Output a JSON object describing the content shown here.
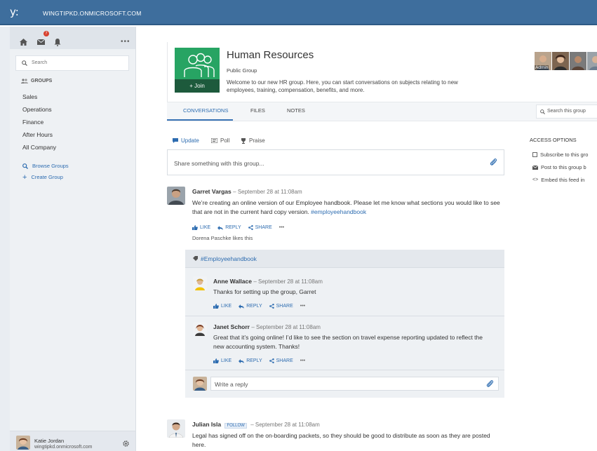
{
  "topbar": {
    "logo": "y:",
    "network_name": "WINGTIPKD.ONMICROSOFT.COM"
  },
  "sidebar": {
    "notification_count": "7",
    "search_placeholder": "Search",
    "groups_heading": "GROUPS",
    "groups": [
      "Sales",
      "Operations",
      "Finance",
      "After Hours",
      "All Company"
    ],
    "browse_groups": "Browse Groups",
    "create_group": "Create Group",
    "user": {
      "name": "Katie Jordan",
      "email": "wingtipkd.onmicrosoft.com"
    }
  },
  "group": {
    "join_label": "+ Join",
    "title": "Human Resources",
    "type": "Public Group",
    "description": "Welcome to our new HR group. Here, you can start conversations on subjects relating to new employees, training, compensation, benefits, and more.",
    "member_admin_label": "Admin",
    "tabs": [
      "CONVERSATIONS",
      "FILES",
      "NOTES"
    ],
    "search_placeholder": "Search this group"
  },
  "access": {
    "heading": "ACCESS OPTIONS",
    "options": [
      "Subscribe to this gro",
      "Post to this group b",
      "Embed this feed in"
    ]
  },
  "publisher": {
    "tabs": [
      "Update",
      "Poll",
      "Praise"
    ],
    "placeholder": "Share something with this group..."
  },
  "actions": {
    "like": "LIKE",
    "reply": "REPLY",
    "share": "SHARE",
    "more": "•••"
  },
  "posts": [
    {
      "author": "Garret Vargas",
      "timestamp": "– September 28 at 11:08am",
      "body": "We’re creating an online version of our Employee handbook. Please let me know what sections you would like to see that are not in the current hard copy version.",
      "hashtag": "#employeehandbook",
      "likes": "Dorena Paschke likes this",
      "thread_tag": "#Employeehandbook",
      "replies": [
        {
          "author": "Anne Wallace",
          "timestamp": "– September 28 at 11:08am",
          "body": "Thanks for setting up the group, Garret"
        },
        {
          "author": "Janet Schorr",
          "timestamp": "– September 28 at 11:08am",
          "body": "Great that it’s going online! I’d like to see the section on travel expense reporting updated to reflect the new accounting system. Thanks!"
        }
      ],
      "reply_placeholder": "Write a reply"
    },
    {
      "author": "Julian Isla",
      "follow_label": "FOLLOW",
      "timestamp": "– September 28 at 11:08am",
      "body": "Legal has signed off on the on-boarding packets, so they should be good to distribute as soon as they are posted here."
    }
  ],
  "colors": {
    "topbar": "#3e6e9d",
    "accent": "#2d6cb0",
    "group_green": "#27a463",
    "join_dark": "#1d5a3c",
    "notification": "#d8412f"
  }
}
